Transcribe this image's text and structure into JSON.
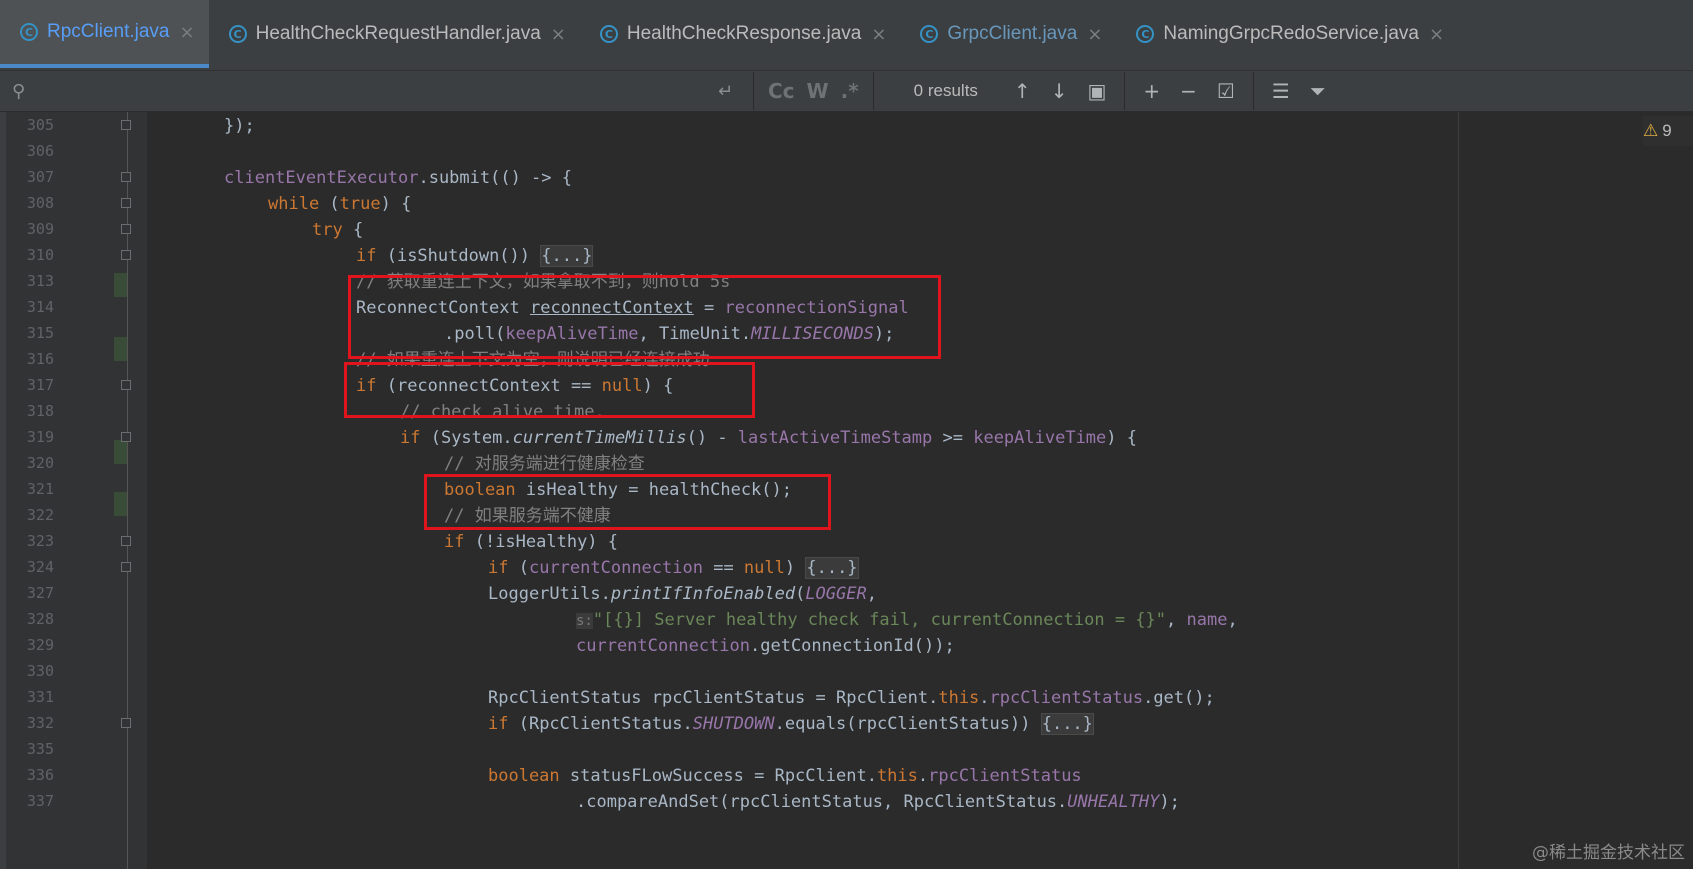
{
  "tabs": [
    {
      "label": "RpcClient.java",
      "active": true
    },
    {
      "label": "HealthCheckRequestHandler.java"
    },
    {
      "label": "HealthCheckResponse.java"
    },
    {
      "label": "GrpcClient.java",
      "vcs": true
    },
    {
      "label": "NamingGrpcRedoService.java"
    }
  ],
  "search": {
    "value": "",
    "options": [
      "Cc",
      "W",
      ".*"
    ],
    "results": "0 results"
  },
  "warning": {
    "count": "9"
  },
  "lines": [
    "305",
    "306",
    "307",
    "308",
    "309",
    "310",
    "313",
    "314",
    "315",
    "316",
    "317",
    "318",
    "319",
    "320",
    "321",
    "322",
    "323",
    "324",
    "327",
    "328",
    "329",
    "330",
    "331",
    "332",
    "335",
    "336",
    "337"
  ],
  "code": {
    "l305": "});",
    "l307a": "clientEventExecutor",
    "l307b": ".submit(() -> {",
    "l308a": "while",
    "l308b": " (",
    "l308c": "true",
    "l308d": ") {",
    "l309a": "try",
    "l309b": " {",
    "l310a": "if",
    "l310b": " (isShutdown()) ",
    "l310c": "{...}",
    "l313": "// 获取重连上下文，如果拿取不到，则hold 5s",
    "l314a": "ReconnectContext ",
    "l314b": "reconnectContext",
    "l314c": " = ",
    "l314d": "reconnectionSignal",
    "l315a": ".poll(",
    "l315b": "keepAliveTime",
    "l315c": ", TimeUnit.",
    "l315d": "MILLISECONDS",
    "l315e": ");",
    "l316": "// 如果重连上下文为空，则说明已经连接成功",
    "l317a": "if",
    "l317b": " (reconnectContext == ",
    "l317c": "null",
    "l317d": ") {",
    "l318": "// check alive time.",
    "l319a": "if",
    "l319b": " (System.",
    "l319c": "currentTimeMillis",
    "l319d": "() - ",
    "l319e": "lastActiveTimeStamp",
    "l319f": " >= ",
    "l319g": "keepAliveTime",
    "l319h": ") {",
    "l320": "// 对服务端进行健康检查",
    "l321a": "boolean",
    "l321b": " isHealthy = healthCheck();",
    "l322": "// 如果服务端不健康",
    "l323a": "if",
    "l323b": " (!isHealthy) {",
    "l324a": "if",
    "l324b": " (",
    "l324c": "currentConnection",
    "l324d": " == ",
    "l324e": "null",
    "l324f": ") ",
    "l324g": "{...}",
    "l327a": "LoggerUtils.",
    "l327b": "printIfInfoEnabled",
    "l327c": "(",
    "l327d": "LOGGER",
    "l327e": ",",
    "l328a": "s:",
    "l328b": "\"[{}] Server healthy check fail, currentConnection = {}\"",
    "l328c": ", ",
    "l328d": "name",
    "l328e": ",",
    "l329a": "currentConnection",
    "l329b": ".getConnectionId());",
    "l331a": "RpcClientStatus rpcClientStatus = RpcClient.",
    "l331b": "this",
    "l331c": ".",
    "l331d": "rpcClientStatus",
    "l331e": ".get();",
    "l332a": "if",
    "l332b": " (RpcClientStatus.",
    "l332c": "SHUTDOWN",
    "l332d": ".equals(rpcClientStatus)) ",
    "l332e": "{...}",
    "l336a": "boolean",
    "l336b": " statusFLowSuccess = RpcClient.",
    "l336c": "this",
    "l336d": ".",
    "l336e": "rpcClientStatus",
    "l337a": ".compareAndSet(rpcClientStatus, RpcClientStatus.",
    "l337b": "UNHEALTHY",
    "l337c": ");"
  },
  "watermark": "@稀土掘金技术社区"
}
